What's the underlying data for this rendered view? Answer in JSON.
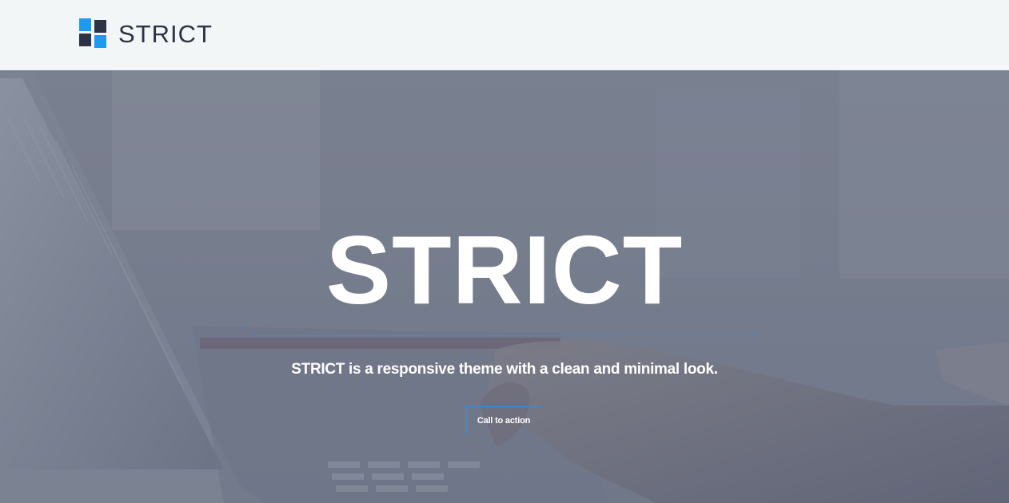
{
  "header": {
    "logo_text": "STRICT"
  },
  "hero": {
    "title": "STRICT",
    "subtitle": "STRICT is a responsive theme with a clean and minimal look.",
    "cta_label": "Call to action"
  },
  "colors": {
    "logo_blue": "#1e9bf0",
    "logo_dark": "#2b3344",
    "accent_line": "#2f8fe8",
    "header_bg": "#f3f6f7"
  }
}
